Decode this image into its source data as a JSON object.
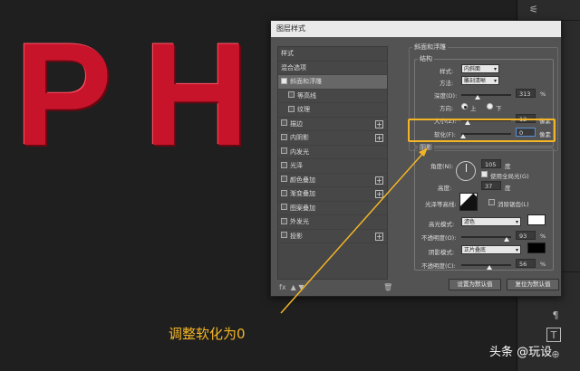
{
  "canvas": {
    "letters": [
      "P",
      "H"
    ]
  },
  "dialog": {
    "title": "图层样式",
    "styles": [
      {
        "label": "样式",
        "cb": false,
        "plus": false,
        "sub": false,
        "checked": false,
        "sel": false
      },
      {
        "label": "混合选项",
        "cb": false,
        "plus": false,
        "sub": false,
        "checked": false,
        "sel": false
      },
      {
        "label": "斜面和浮雕",
        "cb": true,
        "plus": false,
        "sub": false,
        "checked": true,
        "sel": true
      },
      {
        "label": "等高线",
        "cb": true,
        "plus": false,
        "sub": true,
        "checked": false,
        "sel": false
      },
      {
        "label": "纹理",
        "cb": true,
        "plus": false,
        "sub": true,
        "checked": false,
        "sel": false
      },
      {
        "label": "描边",
        "cb": true,
        "plus": true,
        "sub": false,
        "checked": false,
        "sel": false
      },
      {
        "label": "内阴影",
        "cb": true,
        "plus": true,
        "sub": false,
        "checked": false,
        "sel": false
      },
      {
        "label": "内发光",
        "cb": true,
        "plus": false,
        "sub": false,
        "checked": false,
        "sel": false
      },
      {
        "label": "光泽",
        "cb": true,
        "plus": false,
        "sub": false,
        "checked": false,
        "sel": false
      },
      {
        "label": "颜色叠加",
        "cb": true,
        "plus": true,
        "sub": false,
        "checked": false,
        "sel": false
      },
      {
        "label": "渐变叠加",
        "cb": true,
        "plus": true,
        "sub": false,
        "checked": false,
        "sel": false
      },
      {
        "label": "图案叠加",
        "cb": true,
        "plus": false,
        "sub": false,
        "checked": false,
        "sel": false
      },
      {
        "label": "外发光",
        "cb": true,
        "plus": false,
        "sub": false,
        "checked": false,
        "sel": false
      },
      {
        "label": "投影",
        "cb": true,
        "plus": true,
        "sub": false,
        "checked": false,
        "sel": false
      }
    ],
    "fx": "fx",
    "bevel": {
      "section_title": "斜面和浮雕",
      "struct_title": "结构",
      "style_label": "样式:",
      "style_value": "内斜面",
      "method_label": "方法:",
      "method_value": "雕刻清晰",
      "depth_label": "深度(D):",
      "depth_value": "313",
      "depth_unit": "%",
      "depth_level": 0.3,
      "dir_label": "方向:",
      "dir_up": "上",
      "dir_down": "下",
      "size_label": "大小(Z):",
      "size_value": "12",
      "size_unit": "像素",
      "size_level": 0.1,
      "soften_label": "软化(F):",
      "soften_value": "0",
      "soften_unit": "像素",
      "soften_level": 0
    },
    "shading": {
      "title": "阴影",
      "angle_label": "角度(N):",
      "angle_value": "105",
      "angle_unit": "度",
      "global_label": "使用全局光(G)",
      "alt_label": "高度:",
      "alt_value": "37",
      "alt_unit": "度",
      "contour_label": "光泽等高线:",
      "anti_label": "消除锯齿(L)",
      "hmode_label": "高光模式:",
      "hmode_value": "滤色",
      "hop_label": "不透明度(O):",
      "hop_value": "93",
      "hop_unit": "%",
      "hop_level": 0.93,
      "smode_label": "阴影模式:",
      "smode_value": "正片叠底",
      "sop_label": "不透明度(C):",
      "sop_value": "56",
      "sop_unit": "%",
      "sop_level": 0.56
    },
    "btn_default": "设置为默认值",
    "btn_reset": "复位为默认值"
  },
  "caption": "调整软化为0",
  "watermark": "头条 @玩设"
}
